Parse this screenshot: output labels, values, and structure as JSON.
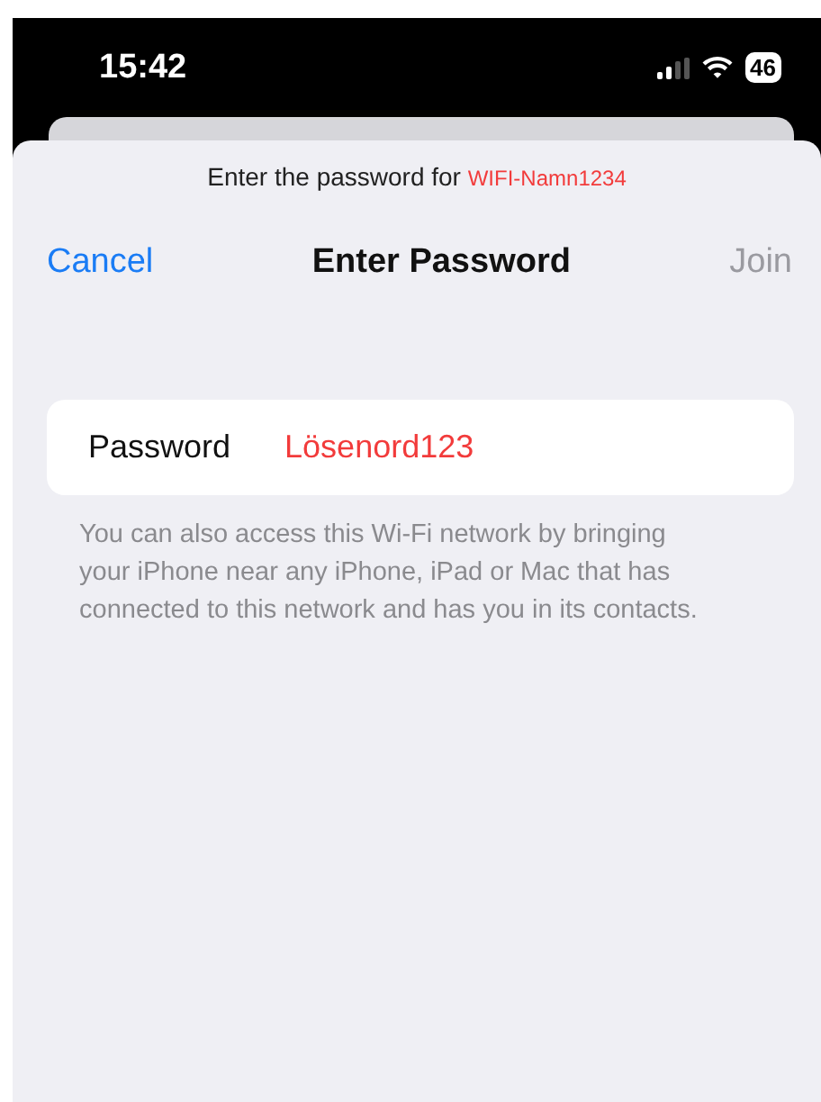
{
  "status_bar": {
    "time": "15:42",
    "battery": "46"
  },
  "sheet": {
    "prompt": "Enter the password for ",
    "network": "WIFI-Namn1234"
  },
  "nav": {
    "cancel": "Cancel",
    "title": "Enter Password",
    "join": {
      "label": "Join",
      "disabled": true
    }
  },
  "form": {
    "label": "Password",
    "value": "Lösenord123"
  },
  "footer": "You can also access this Wi-Fi network by bringing your iPhone near any iPhone, iPad or Mac that has connected to this network and has you in its contacts."
}
